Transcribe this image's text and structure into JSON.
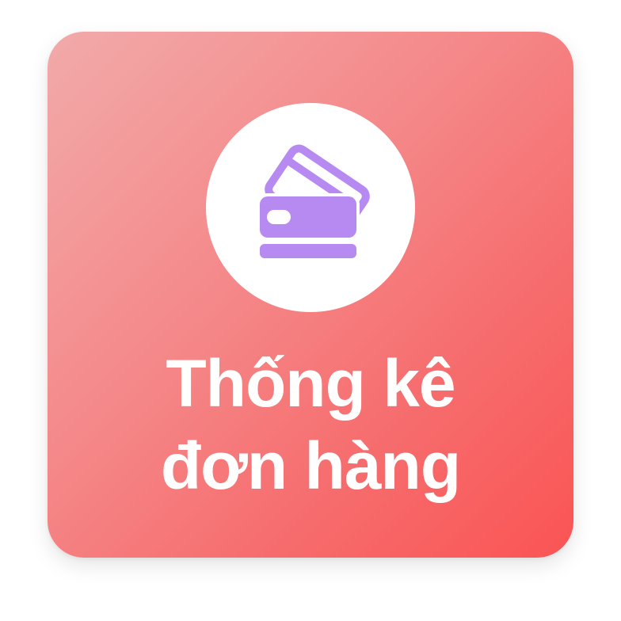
{
  "tile": {
    "title_line1": "Thống kê",
    "title_line2": "đơn hàng",
    "icon": "credit-cards-icon",
    "icon_color": "#b68af0",
    "gradient_start": "#f2aaaa",
    "gradient_end": "#fb5454"
  }
}
